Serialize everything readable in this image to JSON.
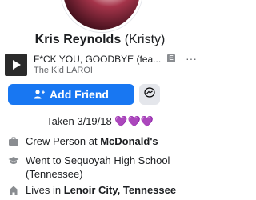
{
  "profile": {
    "name": "Kris Reynolds",
    "nickname": "(Kristy)"
  },
  "song": {
    "title": "F*CK YOU, GOODBYE (fea...",
    "artist": "The Kid LAROI",
    "explicit_badge": "E",
    "more_label": "···"
  },
  "actions": {
    "add_friend_label": "Add Friend",
    "messenger_icon": "messenger-icon"
  },
  "bio": {
    "text": "Taken 3/19/18",
    "hearts": "💜💜💜"
  },
  "intro": {
    "work_prefix": "Crew Person at ",
    "work_place": "McDonald's",
    "school_text": "Went to Sequoyah High School (Tennessee)",
    "lives_prefix": "Lives in ",
    "lives_place": "Lenoir City, Tennessee"
  },
  "colors": {
    "primary": "#1877f2",
    "secondary_bg": "#e4e6eb",
    "muted_text": "#65676b",
    "heart": "#9b51e0"
  }
}
